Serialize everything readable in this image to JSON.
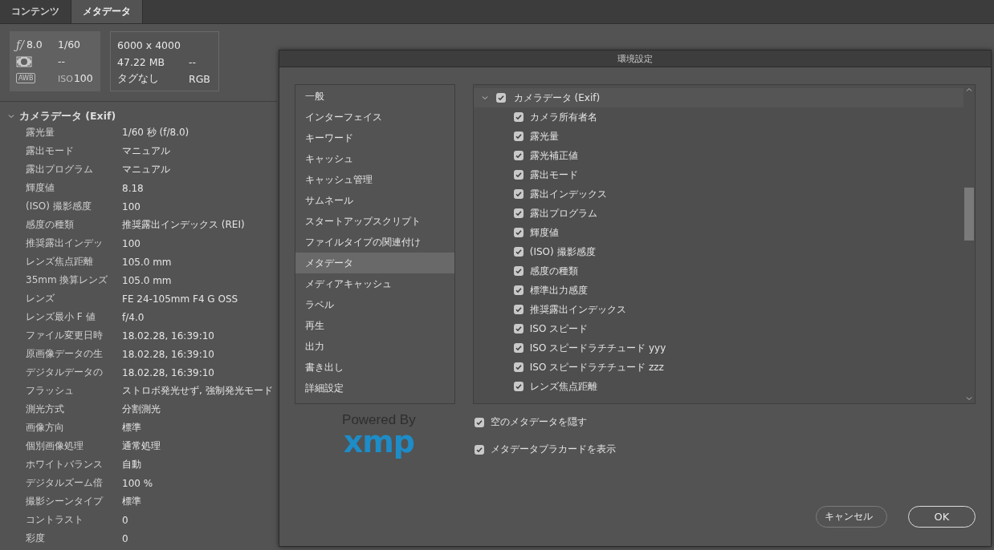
{
  "tabs": [
    {
      "label": "コンテンツ",
      "selected": false
    },
    {
      "label": "メタデータ",
      "selected": true
    }
  ],
  "placard": {
    "aperture_symbol": "ƒ/",
    "aperture": "8.0",
    "shutter": "1/60",
    "metering_value": "--",
    "wb_badge": "AWB",
    "iso_label": "ISO",
    "iso": "100",
    "dimensions": "6000 x 4000",
    "file_size": "47.22 MB",
    "column_2_value": "--",
    "tags": "タグなし",
    "color_mode": "RGB"
  },
  "metadata_panel": {
    "section": {
      "title": "カメラデータ (Exif)",
      "expanded": true
    },
    "rows": [
      {
        "label": "露光量",
        "value": "1/60 秒 (f/8.0)"
      },
      {
        "label": "露出モード",
        "value": "マニュアル"
      },
      {
        "label": "露出プログラム",
        "value": "マニュアル"
      },
      {
        "label": "輝度値",
        "value": "8.18"
      },
      {
        "label": "(ISO) 撮影感度",
        "value": "100"
      },
      {
        "label": "感度の種類",
        "value": "推奨露出インデックス (REI)"
      },
      {
        "label": "推奨露出インデッ",
        "value": "100"
      },
      {
        "label": "レンズ焦点距離",
        "value": "105.0 mm"
      },
      {
        "label": "35mm 換算レンズ",
        "value": "105.0 mm"
      },
      {
        "label": "レンズ",
        "value": "FE 24-105mm F4 G OSS"
      },
      {
        "label": "レンズ最小 F 値",
        "value": "f/4.0"
      },
      {
        "label": "ファイル変更日時",
        "value": "18.02.28, 16:39:10"
      },
      {
        "label": "原画像データの生",
        "value": "18.02.28, 16:39:10"
      },
      {
        "label": "デジタルデータの",
        "value": "18.02.28, 16:39:10"
      },
      {
        "label": "フラッシュ",
        "value": "ストロボ発光せず, 強制発光モード"
      },
      {
        "label": "測光方式",
        "value": "分割測光"
      },
      {
        "label": "画像方向",
        "value": "標準"
      },
      {
        "label": "個別画像処理",
        "value": "通常処理"
      },
      {
        "label": "ホワイトバランス",
        "value": "自動"
      },
      {
        "label": "デジタルズーム倍",
        "value": "100 %"
      },
      {
        "label": "撮影シーンタイプ",
        "value": "標準"
      },
      {
        "label": "コントラスト",
        "value": "0"
      },
      {
        "label": "彩度",
        "value": "0"
      }
    ]
  },
  "dialog": {
    "title": "環境設定",
    "categories": [
      {
        "label": "一般",
        "selected": false
      },
      {
        "label": "インターフェイス",
        "selected": false
      },
      {
        "label": "キーワード",
        "selected": false
      },
      {
        "label": "キャッシュ",
        "selected": false
      },
      {
        "label": "キャッシュ管理",
        "selected": false
      },
      {
        "label": "サムネール",
        "selected": false
      },
      {
        "label": "スタートアップスクリプト",
        "selected": false
      },
      {
        "label": "ファイルタイプの関連付け",
        "selected": false
      },
      {
        "label": "メタデータ",
        "selected": true
      },
      {
        "label": "メディアキャッシュ",
        "selected": false
      },
      {
        "label": "ラベル",
        "selected": false
      },
      {
        "label": "再生",
        "selected": false
      },
      {
        "label": "出力",
        "selected": false
      },
      {
        "label": "書き出し",
        "selected": false
      },
      {
        "label": "詳細設定",
        "selected": false
      }
    ],
    "fields_tree": {
      "group": {
        "label": "カメラデータ (Exif)",
        "checked": true,
        "expanded": true
      },
      "items": [
        {
          "label": "カメラ所有者名",
          "checked": true
        },
        {
          "label": "露光量",
          "checked": true
        },
        {
          "label": "露光補正値",
          "checked": true
        },
        {
          "label": "露出モード",
          "checked": true
        },
        {
          "label": "露出インデックス",
          "checked": true
        },
        {
          "label": "露出プログラム",
          "checked": true
        },
        {
          "label": "輝度値",
          "checked": true
        },
        {
          "label": "(ISO) 撮影感度",
          "checked": true
        },
        {
          "label": "感度の種類",
          "checked": true
        },
        {
          "label": "標準出力感度",
          "checked": true
        },
        {
          "label": "推奨露出インデックス",
          "checked": true
        },
        {
          "label": "ISO スピード",
          "checked": true
        },
        {
          "label": "ISO スピードラチチュード yyy",
          "checked": true
        },
        {
          "label": "ISO スピードラチチュード zzz",
          "checked": true
        },
        {
          "label": "レンズ焦点距離",
          "checked": true
        }
      ]
    },
    "options": [
      {
        "label": "空のメタデータを隠す",
        "checked": true
      },
      {
        "label": "メタデータプラカードを表示",
        "checked": true
      }
    ],
    "logo": {
      "powered_by": "Powered By",
      "brand": "xmp"
    },
    "buttons": [
      {
        "label": "キャンセル",
        "kind": "secondary"
      },
      {
        "label": "OK",
        "kind": "primary"
      }
    ]
  }
}
